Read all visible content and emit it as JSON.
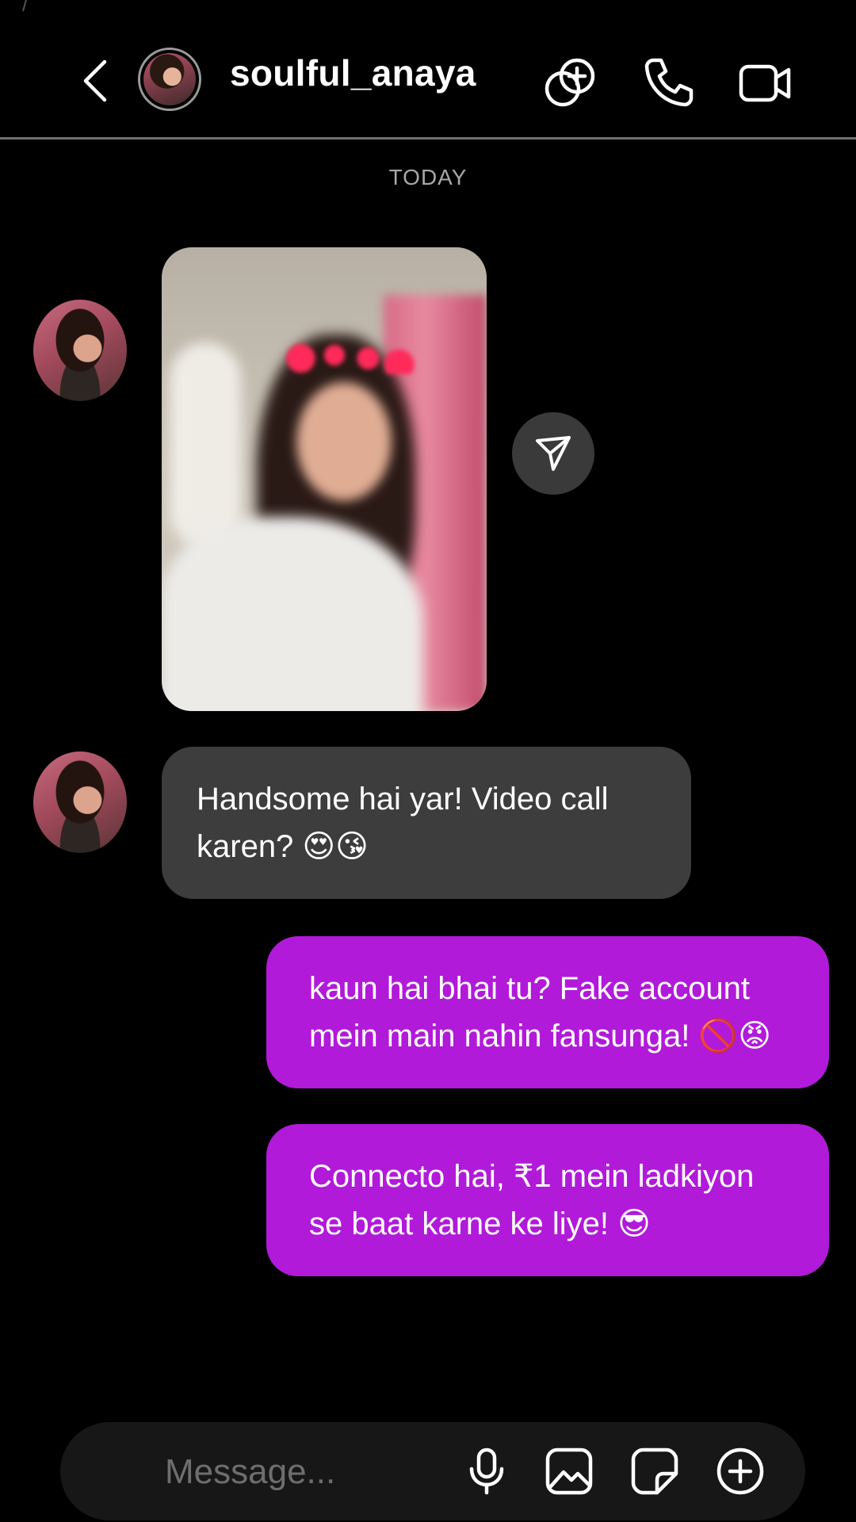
{
  "header": {
    "username": "soulful_anaya",
    "icons": [
      "back-chevron-icon",
      "avatar",
      "add-to-group-icon",
      "phone-icon",
      "video-camera-icon"
    ]
  },
  "thread": {
    "date_separator": "TODAY",
    "messages": [
      {
        "from": "them",
        "type": "photo"
      },
      {
        "from": "them",
        "type": "text",
        "line1": "Handsome hai yar! Video call",
        "line2": "karen? 😍😘"
      },
      {
        "from": "me",
        "type": "text",
        "line1": "kaun hai bhai tu? Fake account",
        "line2": "mein main nahin fansunga! 🚫😡"
      },
      {
        "from": "me",
        "type": "text",
        "line1": "Connecto hai, ₹1 mein ladkiyon",
        "line2": "se baat karne ke liye! 😎"
      }
    ]
  },
  "composer": {
    "placeholder": "Message...",
    "icons": [
      "microphone-icon",
      "gallery-icon",
      "sticker-icon",
      "plus-circle-icon"
    ]
  },
  "colors": {
    "background": "#000000",
    "incoming_bubble": "#3d3d3d",
    "outgoing_bubble": "#b11ad9",
    "composer": "#171717"
  }
}
